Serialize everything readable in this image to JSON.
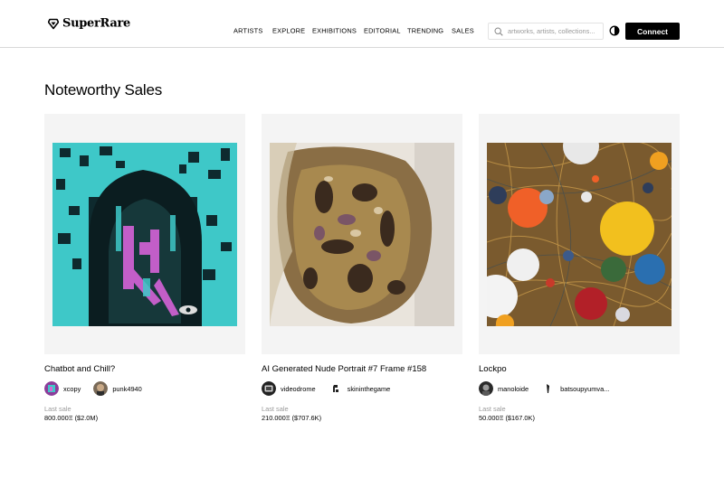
{
  "brand": {
    "name": "SuperRare"
  },
  "nav": [
    {
      "label": "ARTISTS",
      "name": "nav-artists"
    },
    {
      "label": "EXPLORE",
      "name": "nav-explore"
    },
    {
      "label": "EXHIBITIONS",
      "name": "nav-exhibitions"
    },
    {
      "label": "EDITORIAL",
      "name": "nav-editorial"
    },
    {
      "label": "TRENDING",
      "name": "nav-trending"
    },
    {
      "label": "SALES",
      "name": "nav-sales"
    }
  ],
  "search": {
    "placeholder": "artworks, artists, collections...",
    "value": "",
    "icon": "search-icon"
  },
  "theme_toggle": {
    "icon": "contrast-icon"
  },
  "connect": {
    "label": "Connect"
  },
  "section": {
    "title": "Noteworthy Sales"
  },
  "colors": {
    "accent": "#000000",
    "card_bg": "#f4f4f4",
    "muted": "#9a9a9a"
  },
  "cards": [
    {
      "title": "Chatbot and Chill?",
      "artist": "xcopy",
      "collector": "punk4940",
      "sale_label": "Last sale",
      "sale_value": "800.000Ξ ($2.0M)"
    },
    {
      "title": "AI Generated Nude Portrait #7 Frame #158",
      "artist": "videodrome",
      "collector": "skininthegame",
      "sale_label": "Last sale",
      "sale_value": "210.000Ξ ($707.6K)"
    },
    {
      "title": "Lockpo",
      "artist": "manoloide",
      "collector": "batsoupyumva...",
      "sale_label": "Last sale",
      "sale_value": "50.000Ξ ($167.0K)"
    }
  ]
}
